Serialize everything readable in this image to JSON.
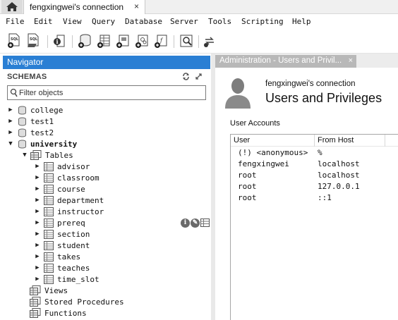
{
  "top_tabs": {
    "connection_tab": "fengxingwei's connection",
    "close_glyph": "×"
  },
  "menu": [
    "File",
    "Edit",
    "View",
    "Query",
    "Database",
    "Server",
    "Tools",
    "Scripting",
    "Help"
  ],
  "toolbar_icons": [
    "new-sql-tab-icon",
    "open-sql-script-icon",
    "schema-inspector-icon",
    "create-schema-icon",
    "create-table-icon",
    "create-view-icon",
    "create-procedure-icon",
    "create-function-icon",
    "search-table-data-icon",
    "reconnect-icon"
  ],
  "navigator": {
    "title": "Navigator",
    "schemas_title": "SCHEMAS",
    "filter_placeholder": "Filter objects",
    "schemas": [
      {
        "name": "college",
        "expanded": false
      },
      {
        "name": "test1",
        "expanded": false
      },
      {
        "name": "test2",
        "expanded": false
      },
      {
        "name": "university",
        "expanded": true
      }
    ],
    "tables_label": "Tables",
    "tables": [
      "advisor",
      "classroom",
      "course",
      "department",
      "instructor",
      "prereq",
      "section",
      "student",
      "takes",
      "teaches",
      "time_slot"
    ],
    "views_label": "Views",
    "procedures_label": "Stored Procedures",
    "functions_label": "Functions",
    "row_actions": [
      "info-icon",
      "edit-icon",
      "table-data-icon"
    ]
  },
  "admin": {
    "tab_label": "Administration - Users and Privil...",
    "tab_close": "×",
    "connection_name": "fengxingwei's connection",
    "page_title": "Users and Privileges",
    "accounts_label": "User Accounts",
    "columns": [
      "User",
      "From Host"
    ],
    "accounts": [
      {
        "user": "(!) <anonymous>",
        "host": "%"
      },
      {
        "user": "fengxingwei",
        "host": "localhost"
      },
      {
        "user": "root",
        "host": "localhost"
      },
      {
        "user": "root",
        "host": "127.0.0.1"
      },
      {
        "user": "root",
        "host": "::1"
      }
    ]
  },
  "colors": {
    "navigator_header": "#2a7fd4",
    "admin_tab": "#b8b8b8"
  }
}
